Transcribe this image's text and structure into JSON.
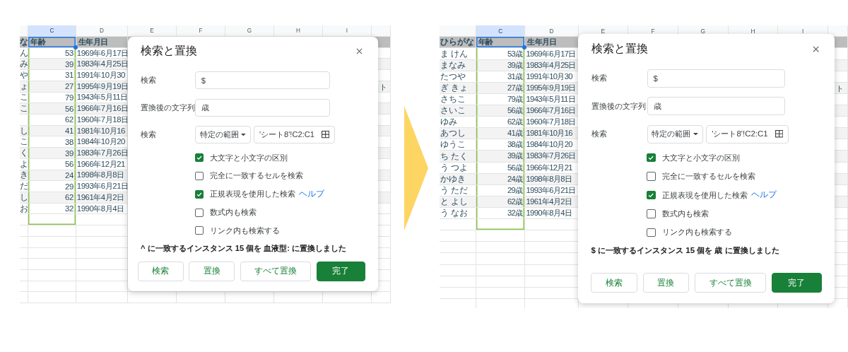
{
  "panels": [
    {
      "sheet": {
        "columns": [
          {
            "letter": "C",
            "selected": true
          },
          {
            "letter": "D",
            "selected": false
          },
          {
            "letter": "E",
            "selected": false
          },
          {
            "letter": "F",
            "selected": false
          },
          {
            "letter": "G",
            "selected": false
          },
          {
            "letter": "H",
            "selected": false
          },
          {
            "letter": "I",
            "selected": false
          }
        ],
        "header": {
          "name": "な",
          "age": "年齢",
          "birth": "生年月日"
        },
        "rows": [
          {
            "name": "ん",
            "age": "53",
            "birth": "1969年6月17日"
          },
          {
            "name": "み",
            "age": "39",
            "birth": "1983年4月25日"
          },
          {
            "name": "や",
            "age": "31",
            "birth": "1991年10月30"
          },
          {
            "name": "ょ",
            "age": "27",
            "birth": "1995年9月19日"
          },
          {
            "name": "こ",
            "age": "79",
            "birth": "1943年5月11日"
          },
          {
            "name": "こ",
            "age": "56",
            "birth": "1966年7月16日"
          },
          {
            "age": "62",
            "birth": "1960年7月18日"
          },
          {
            "name": "し",
            "age": "41",
            "birth": "1981年10月16"
          },
          {
            "name": "こ",
            "age": "38",
            "birth": "1984年10月20"
          },
          {
            "name": "く",
            "age": "39",
            "birth": "1983年7月26日"
          },
          {
            "name": "よ",
            "age": "56",
            "birth": "1966年12月21"
          },
          {
            "name": "き",
            "age": "24",
            "birth": "1998年8月8日"
          },
          {
            "name": "だ",
            "age": "29",
            "birth": "1993年6月21日"
          },
          {
            "name": "し",
            "age": "62",
            "birth": "1961年4月2日"
          },
          {
            "name": "お",
            "age": "32",
            "birth": "1990年8月4日"
          }
        ],
        "overflow_text": "ト"
      },
      "dialog": {
        "title": "検索と置換",
        "fields": [
          {
            "label": "検索",
            "value": "$"
          },
          {
            "label": "置換後の文字列",
            "value": "歳"
          }
        ],
        "scope": {
          "label": "検索",
          "select": "特定の範囲",
          "range": "'シート8'!C2:C1"
        },
        "options": [
          {
            "label": "大文字と小文字の区別",
            "checked": true
          },
          {
            "label": "完全に一致するセルを検索",
            "checked": false
          },
          {
            "label": "正規表現を使用した検索",
            "checked": true,
            "help": "ヘルプ"
          },
          {
            "label": "数式内も検索",
            "checked": false
          },
          {
            "label": "リンク内も検索する",
            "checked": false
          }
        ],
        "status": "^ に一致するインスタンス 15 個を 血液型: に置換しました",
        "buttons": [
          {
            "label": "検索",
            "kind": "secondary"
          },
          {
            "label": "置換",
            "kind": "secondary"
          },
          {
            "label": "すべて置換",
            "kind": "secondary"
          },
          {
            "label": "完了",
            "kind": "primary"
          }
        ]
      }
    },
    {
      "sheet": {
        "columns": [
          {
            "letter": "C",
            "selected": true
          },
          {
            "letter": "D",
            "selected": false
          },
          {
            "letter": "E",
            "selected": false
          },
          {
            "letter": "F",
            "selected": false
          },
          {
            "letter": "G",
            "selected": false
          },
          {
            "letter": "H",
            "selected": false
          },
          {
            "letter": "I",
            "selected": false
          }
        ],
        "header": {
          "name": "ひらがな",
          "age": "年齢",
          "birth": "生年月日"
        },
        "rows": [
          {
            "name": "ま けん",
            "age": "53歳",
            "birth": "1969年6月17日"
          },
          {
            "name": "まなみ",
            "age": "39歳",
            "birth": "1983年4月25日"
          },
          {
            "name": "たつや",
            "age": "31歳",
            "birth": "1991年10月30"
          },
          {
            "name": "ぎ きょ",
            "age": "27歳",
            "birth": "1995年9月19日"
          },
          {
            "name": "さちこ",
            "age": "79歳",
            "birth": "1943年5月11日"
          },
          {
            "name": "さいこ",
            "age": "56歳",
            "birth": "1966年7月16日"
          },
          {
            "name": "ゆみ",
            "age": "62歳",
            "birth": "1960年7月18日"
          },
          {
            "name": "あつし",
            "age": "41歳",
            "birth": "1981年10月16"
          },
          {
            "name": "ゆうこ",
            "age": "38歳",
            "birth": "1984年10月20"
          },
          {
            "name": "ち たく",
            "age": "39歳",
            "birth": "1983年7月26日"
          },
          {
            "name": "う つよ",
            "age": "56歳",
            "birth": "1966年12月21"
          },
          {
            "name": "かゆき",
            "age": "24歳",
            "birth": "1998年8月8日"
          },
          {
            "name": "う ただ",
            "age": "29歳",
            "birth": "1993年6月21日"
          },
          {
            "name": "と よし",
            "age": "62歳",
            "birth": "1961年4月2日"
          },
          {
            "name": "う なお",
            "age": "32歳",
            "birth": "1990年8月4日"
          }
        ],
        "overflow_text": "ト"
      },
      "dialog": {
        "title": "検索と置換",
        "fields": [
          {
            "label": "検索",
            "value": "$"
          },
          {
            "label": "置換後の文字列",
            "value": "歳"
          }
        ],
        "scope": {
          "label": "検索",
          "select": "特定の範囲",
          "range": "'シート8'!C2:C1"
        },
        "options": [
          {
            "label": "大文字と小文字の区別",
            "checked": true
          },
          {
            "label": "完全に一致するセルを検索",
            "checked": false
          },
          {
            "label": "正規表現を使用した検索",
            "checked": true,
            "help": "ヘルプ"
          },
          {
            "label": "数式内も検索",
            "checked": false
          },
          {
            "label": "リンク内も検索する",
            "checked": false
          }
        ],
        "status": "$ に一致するインスタンス 15 個を 歳 に置換しました",
        "buttons": [
          {
            "label": "検索",
            "kind": "secondary"
          },
          {
            "label": "置換",
            "kind": "secondary"
          },
          {
            "label": "すべて置換",
            "kind": "secondary"
          },
          {
            "label": "完了",
            "kind": "primary"
          }
        ]
      }
    }
  ]
}
